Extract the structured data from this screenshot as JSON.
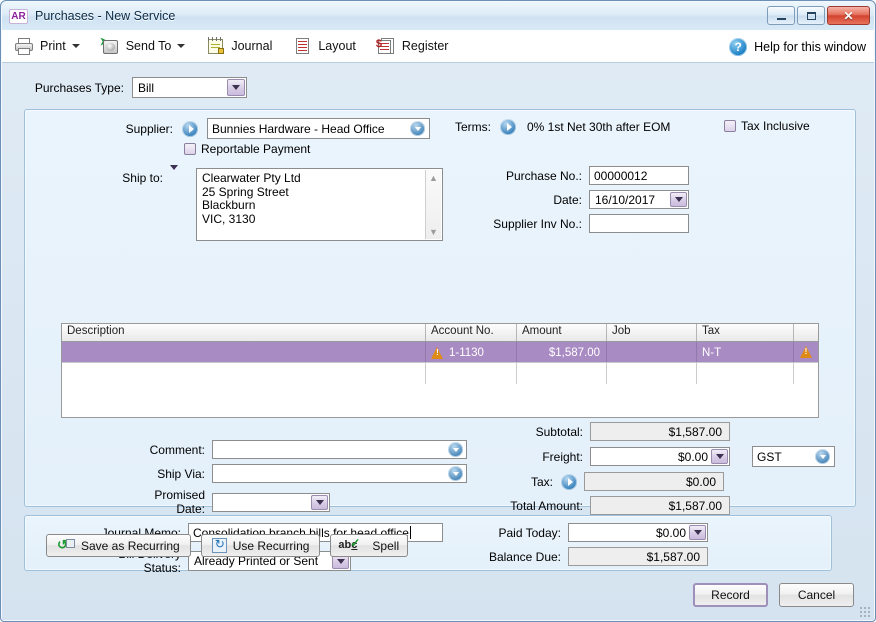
{
  "window": {
    "app_badge": "AR",
    "title": "Purchases - New Service",
    "minimize": "–",
    "maximize": "▭",
    "close": "✕"
  },
  "toolbar": {
    "print": "Print",
    "send_to": "Send To",
    "journal": "Journal",
    "layout": "Layout",
    "register": "Register",
    "help": "Help for this window"
  },
  "form": {
    "purchases_type_label": "Purchases Type:",
    "purchases_type_value": "Bill",
    "supplier_label": "Supplier:",
    "supplier_value": "Bunnies Hardware - Head Office",
    "reportable_payment_label": "Reportable Payment",
    "terms_label": "Terms:",
    "terms_value": "0% 1st Net 30th after EOM",
    "tax_inclusive_label": "Tax Inclusive",
    "ship_to_label": "Ship to:",
    "ship_to_value": "Clearwater Pty Ltd\n25 Spring Street\nBlackburn\nVIC, 3130",
    "purchase_no_label": "Purchase No.:",
    "purchase_no_value": "00000012",
    "date_label": "Date:",
    "date_value": "16/10/2017",
    "supplier_inv_label": "Supplier Inv No.:",
    "supplier_inv_value": "",
    "comment_label": "Comment:",
    "comment_value": "",
    "ship_via_label": "Ship Via:",
    "ship_via_value": "",
    "promised_date_label": "Promised Date:",
    "promised_date_value": "",
    "journal_memo_label": "Journal Memo:",
    "journal_memo_value": "Consolidation branch bills for head office",
    "bill_delivery_label": "Bill Delivery Status:",
    "bill_delivery_value": "Already Printed or Sent"
  },
  "grid": {
    "columns": [
      "Description",
      "Account No.",
      "Amount",
      "Job",
      "Tax",
      ""
    ],
    "rows": [
      {
        "description": "",
        "account_no": "1-1130",
        "account_warning": true,
        "amount": "$1,587.00",
        "job": "",
        "tax": "N-T",
        "row_warning": true,
        "selected": true
      }
    ]
  },
  "totals": {
    "subtotal_label": "Subtotal:",
    "subtotal_value": "$1,587.00",
    "freight_label": "Freight:",
    "freight_value": "$0.00",
    "tax_label": "Tax:",
    "tax_value": "$0.00",
    "total_label": "Total Amount:",
    "total_value": "$1,587.00",
    "tax_code_value": "GST",
    "paid_today_label": "Paid Today:",
    "paid_today_value": "$0.00",
    "balance_due_label": "Balance Due:",
    "balance_due_value": "$1,587.00"
  },
  "actions": {
    "save_as_recurring": "Save as Recurring",
    "use_recurring": "Use Recurring",
    "spell": "Spell",
    "record": "Record",
    "cancel": "Cancel"
  },
  "colors": {
    "selected_row": "#a98bc4",
    "panel_bg": "#e9f3fb",
    "window_chrome": "#cfe0ef",
    "accent_blue": "#2a78b6",
    "warning_orange": "#e08a16",
    "badge_purple": "#8a1f9c"
  }
}
